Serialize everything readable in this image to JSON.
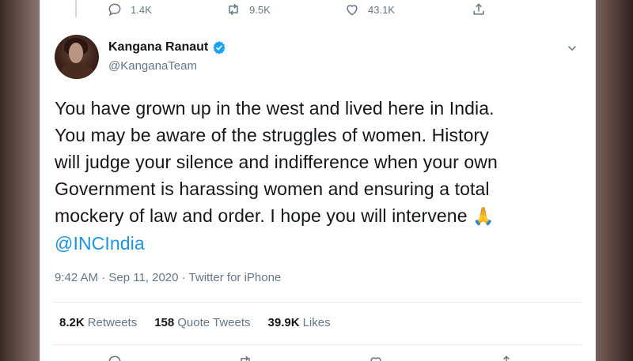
{
  "previous_tweet": {
    "reply_count": "1.4K",
    "retweet_count": "9.5K",
    "like_count": "43.1K"
  },
  "author": {
    "name": "Kangana Ranaut",
    "handle": "@KanganaTeam",
    "verified": true
  },
  "tweet": {
    "text_line1": "You have grown up in the west and lived here in India.",
    "text_line2": "You may be aware of the struggles of women. History",
    "text_line3": "will judge your silence and indifference when your own",
    "text_line4": "Government is harassing women and ensuring a total",
    "text_line5": "mockery of law and order. I hope you will intervene",
    "emoji": "🙏",
    "mention": "@INCIndia",
    "meta": "9:42 AM · Sep 11, 2020 · Twitter for iPhone"
  },
  "stats": {
    "retweets_count": "8.2K",
    "retweets_label": "Retweets",
    "quotes_count": "158",
    "quotes_label": "Quote Tweets",
    "likes_count": "39.9K",
    "likes_label": "Likes"
  },
  "colors": {
    "accent": "#1b95e0",
    "muted": "#657786",
    "text": "#14171a"
  },
  "icons": {
    "reply": "reply-icon",
    "retweet": "retweet-icon",
    "like": "heart-icon",
    "share": "share-icon",
    "verified": "verified-badge-icon",
    "more": "chevron-down-icon"
  }
}
